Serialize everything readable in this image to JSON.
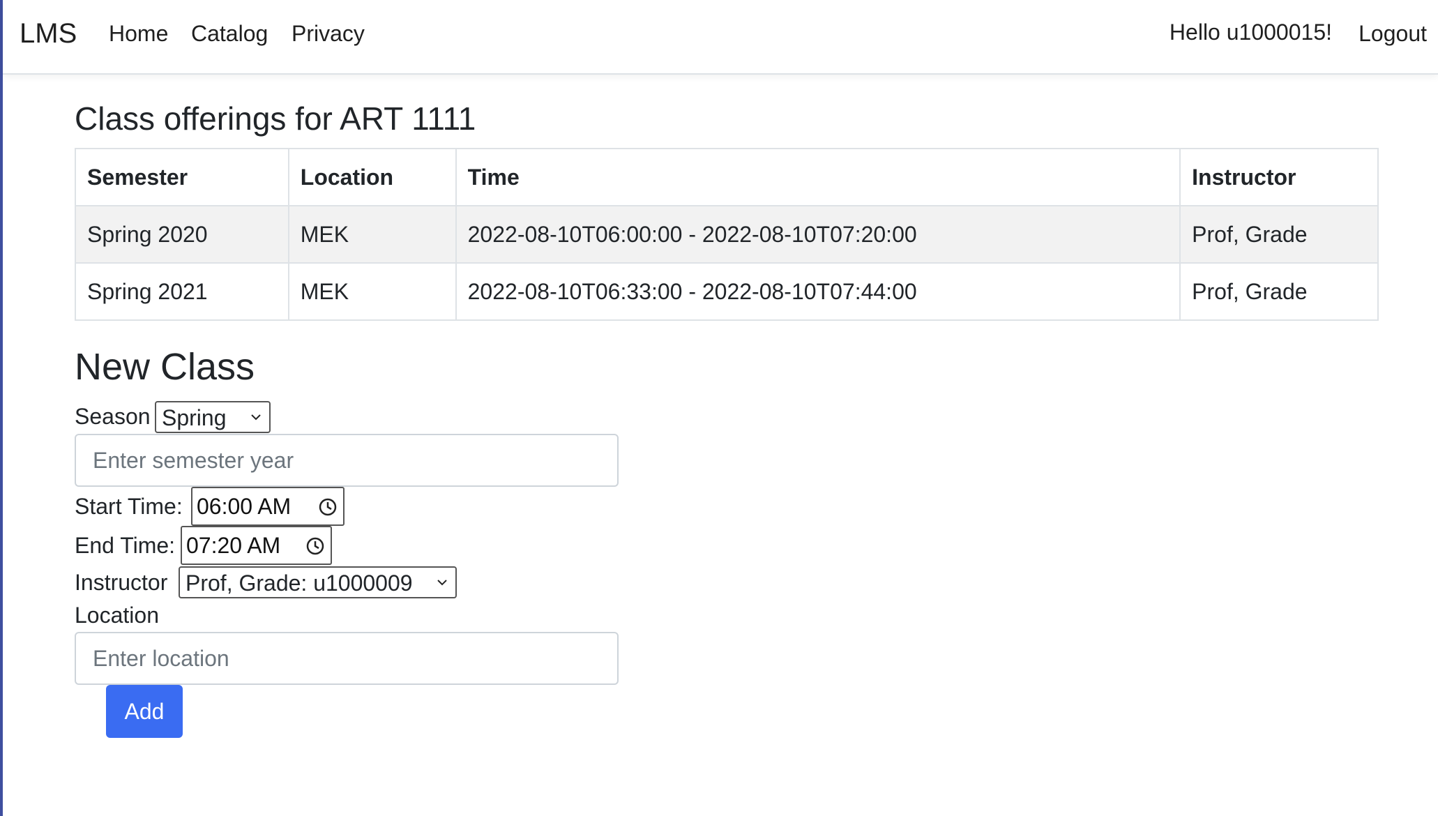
{
  "navbar": {
    "brand": "LMS",
    "links": [
      "Home",
      "Catalog",
      "Privacy"
    ],
    "greeting": "Hello u1000015!",
    "logout": "Logout"
  },
  "page": {
    "title": "Class offerings for ART 1111",
    "table": {
      "headers": [
        "Semester",
        "Location",
        "Time",
        "Instructor"
      ],
      "rows": [
        [
          "Spring 2020",
          "MEK",
          "2022-08-10T06:00:00 - 2022-08-10T07:20:00",
          "Prof, Grade"
        ],
        [
          "Spring 2021",
          "MEK",
          "2022-08-10T06:33:00 - 2022-08-10T07:44:00",
          "Prof, Grade"
        ]
      ]
    }
  },
  "form": {
    "title": "New Class",
    "season_label": "Season",
    "season_value": "Spring",
    "year_placeholder": "Enter semester year",
    "start_label": "Start Time:",
    "start_value": "06:00  AM",
    "end_label": "End Time:",
    "end_value": "07:20  AM",
    "instructor_label": "Instructor",
    "instructor_value": "Prof, Grade: u1000009",
    "location_label": "Location",
    "location_placeholder": "Enter location",
    "add_button": "Add"
  },
  "colors": {
    "primary_button": "#3a6cf2",
    "left_edge": "#3f4f9f",
    "striped_row": "#f2f2f2"
  }
}
